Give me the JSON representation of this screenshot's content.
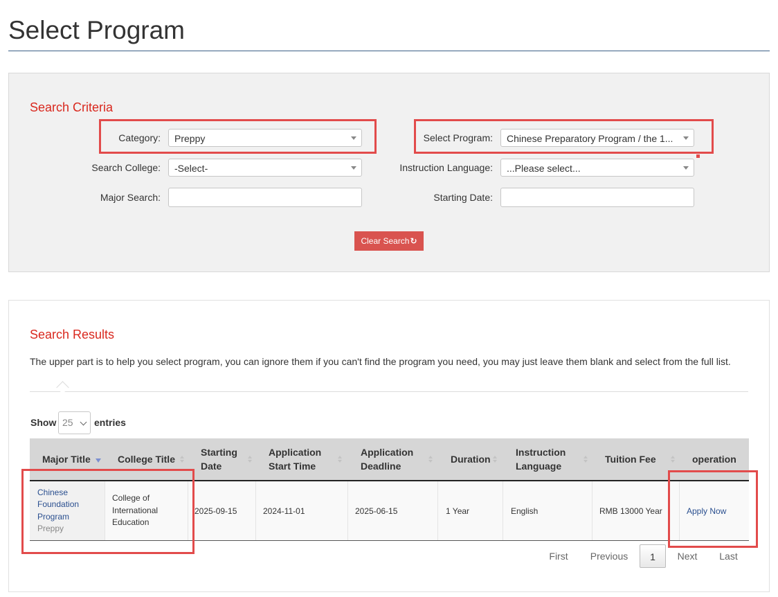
{
  "page": {
    "title": "Select Program"
  },
  "criteria": {
    "heading": "Search Criteria",
    "category": {
      "label": "Category:",
      "value": "Preppy"
    },
    "program": {
      "label": "Select Program:",
      "value": "Chinese Preparatory Program / the 1..."
    },
    "college": {
      "label": "Search College:",
      "value": "-Select-"
    },
    "language": {
      "label": "Instruction Language:",
      "value": "...Please select..."
    },
    "major": {
      "label": "Major Search:",
      "value": ""
    },
    "start_date": {
      "label": "Starting Date:",
      "value": ""
    },
    "clear_button": "Clear Search",
    "clear_icon": "refresh-icon"
  },
  "results": {
    "heading": "Search Results",
    "help_text": "The upper part is to help you select program, you can ignore them if you can't find the program you need, you may just leave them blank and select from the full list.",
    "show_label": "Show",
    "entries_label": "entries",
    "page_length": "25",
    "columns": {
      "major_title": "Major Title",
      "college_title": "College Title",
      "starting_date_1": "Starting",
      "starting_date_2": "Date",
      "app_start_1": "Application",
      "app_start_2": "Start Time",
      "app_deadline_1": "Application",
      "app_deadline_2": "Deadline",
      "duration": "Duration",
      "instruction_1": "Instruction",
      "instruction_2": "Language",
      "tuition": "Tuition Fee",
      "operation": "operation"
    },
    "rows": [
      {
        "major_line1": "Chinese",
        "major_line2": "Foundation",
        "major_line3": "Program",
        "category": "Preppy",
        "college_line1": "College of",
        "college_line2": "International",
        "college_line3": "Education",
        "starting_date": "2025-09-15",
        "app_start": "2024-11-01",
        "app_deadline": "2025-06-15",
        "duration": "1 Year",
        "language": "English",
        "tuition": "RMB 13000 Year",
        "action": "Apply Now"
      }
    ],
    "pagination": {
      "first": "First",
      "previous": "Previous",
      "current": "1",
      "next": "Next",
      "last": "Last"
    }
  },
  "colors": {
    "accent_red": "#d9281e",
    "highlight": "#e24b4b",
    "button": "#d9534f",
    "link": "#2a4f8f"
  }
}
